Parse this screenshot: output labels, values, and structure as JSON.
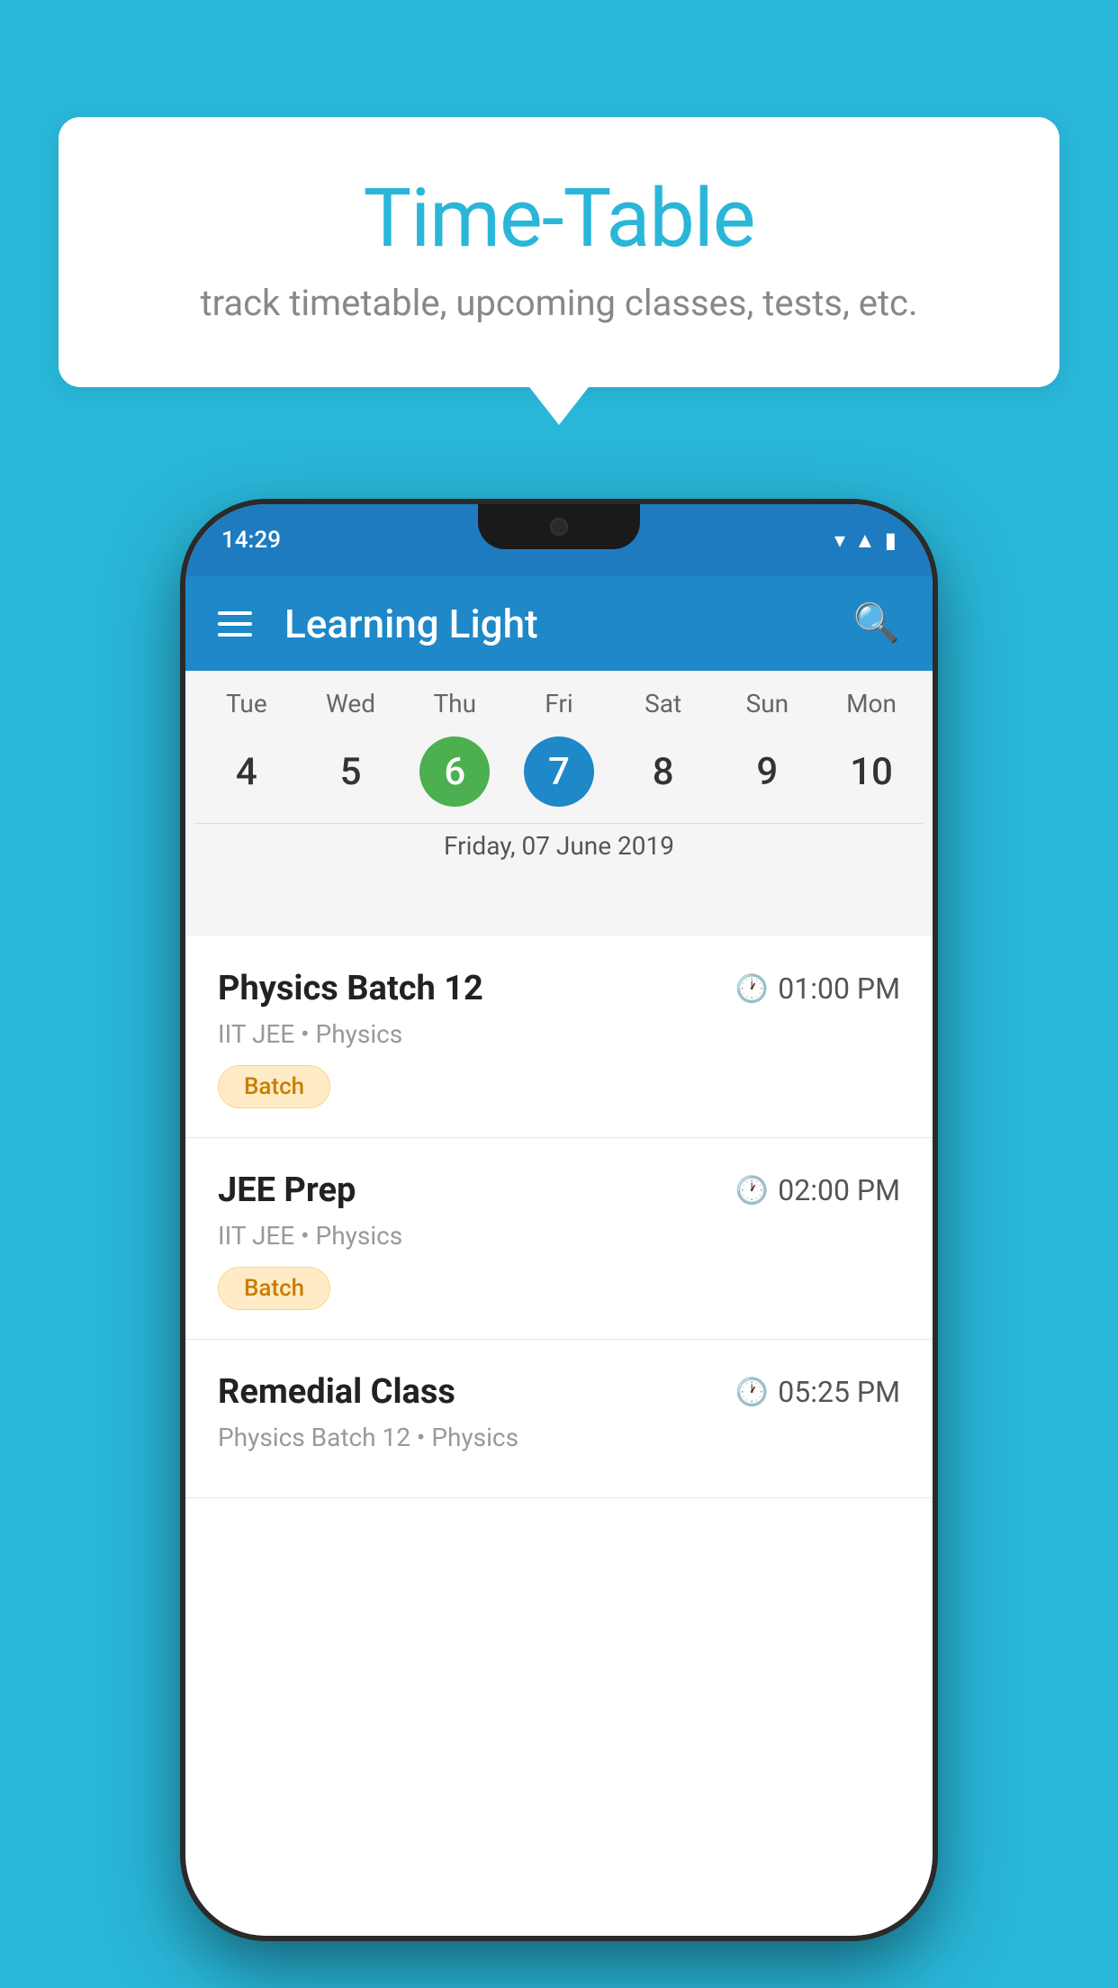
{
  "background_color": "#29b6d8",
  "bubble": {
    "title": "Time-Table",
    "subtitle": "track timetable, upcoming classes, tests, etc."
  },
  "phone": {
    "status_bar": {
      "time": "14:29"
    },
    "app_bar": {
      "title": "Learning Light"
    },
    "calendar": {
      "days_of_week": [
        "Tue",
        "Wed",
        "Thu",
        "Fri",
        "Sat",
        "Sun",
        "Mon"
      ],
      "dates": [
        "4",
        "5",
        "6",
        "7",
        "8",
        "9",
        "10"
      ],
      "today_index": 2,
      "selected_index": 3,
      "selected_date_label": "Friday, 07 June 2019"
    },
    "schedule": [
      {
        "title": "Physics Batch 12",
        "time": "01:00 PM",
        "meta": "IIT JEE • Physics",
        "badge": "Batch"
      },
      {
        "title": "JEE Prep",
        "time": "02:00 PM",
        "meta": "IIT JEE • Physics",
        "badge": "Batch"
      },
      {
        "title": "Remedial Class",
        "time": "05:25 PM",
        "meta": "Physics Batch 12 • Physics",
        "badge": null
      }
    ]
  }
}
